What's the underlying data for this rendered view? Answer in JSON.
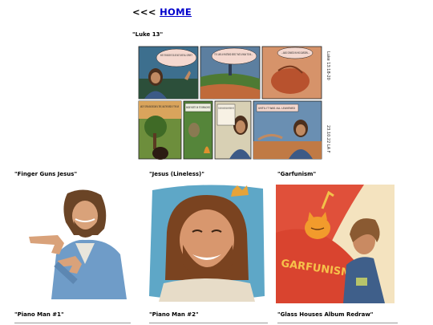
{
  "nav": {
    "arrows": "<<<",
    "home_label": "HOME"
  },
  "gallery": {
    "comic": {
      "title": "\"Luke 13\"",
      "panels": [
        "WHAT IS THE KINGDOM OF GOD LIKE? AND TO WHAT SHALL I COMPARE IT?",
        "IT IS LIKE A MUSTARD SEED THAT A MAN TOOK...",
        "...AND SOWED IN HIS GARDEN --",
        "AND IT GREW AND BECAME A TREE, AND THE BIRDS OF THE AIR",
        "MADE NESTS IN ITS BRANCHES",
        "IT IS LIKE LEAVEN THAT A WOMAN TOOK AND HID IN THREE MEASURES OF FLOUR",
        "UNTIL IT WAS ALL LEAVENED"
      ],
      "side_top": "Luke 13:18-20",
      "side_bottom": "23.10.22 LA F"
    },
    "row1": [
      {
        "title": "\"Finger Guns Jesus\""
      },
      {
        "title": "\"Jesus (Lineless)\""
      },
      {
        "title": "\"Garfunism\"",
        "banner_text": "GARFUNISM"
      }
    ],
    "row2": [
      {
        "title": "\"Piano Man #1\""
      },
      {
        "title": "\"Piano Man #2\""
      },
      {
        "title": "\"Glass Houses Album Redraw\""
      }
    ]
  }
}
